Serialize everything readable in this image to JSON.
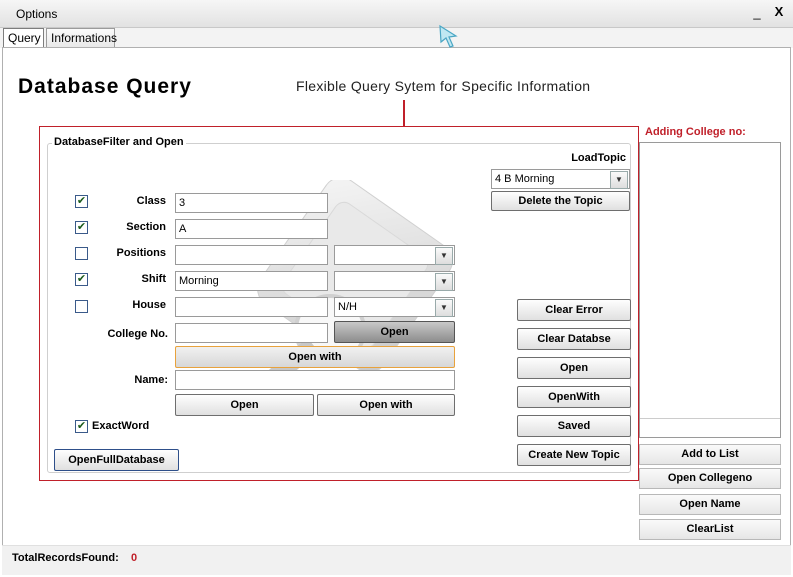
{
  "window": {
    "title": "Options",
    "minimize": "_",
    "close": "X"
  },
  "tabs": [
    {
      "label": "Query"
    },
    {
      "label": "Informations"
    }
  ],
  "page": {
    "title": "Database Query",
    "subtitle": "Flexible Query Sytem for Specific Information"
  },
  "filter": {
    "group_title": "DatabaseFilter and Open",
    "load_topic_label": "LoadTopic",
    "load_topic_value": "4 B Morning",
    "delete_topic": "Delete the Topic",
    "fields": {
      "class": {
        "label": "Class",
        "value": "3",
        "checked": true
      },
      "section": {
        "label": "Section",
        "value": "A",
        "checked": true
      },
      "positions": {
        "label": "Positions",
        "value": "",
        "checked": false,
        "select": ""
      },
      "shift": {
        "label": "Shift",
        "value": "Morning",
        "checked": true,
        "select": ""
      },
      "house": {
        "label": "House",
        "value": "",
        "checked": false,
        "select": "N/H"
      }
    },
    "college_no_label": "College No.",
    "college_no_value": "",
    "open_btn": "Open",
    "open_with_btn": "Open with",
    "name_label": "Name:",
    "name_value": "",
    "name_open_btn": "Open",
    "name_open_with_btn": "Open with",
    "exact_word_label": "ExactWord",
    "exact_word_checked": true,
    "open_full_db": "OpenFullDatabase"
  },
  "actions": {
    "clear_error": "Clear Error",
    "clear_database": "Clear Databse",
    "open": "Open",
    "open_with": "OpenWith",
    "saved": "Saved",
    "create_new_topic": "Create New Topic"
  },
  "college_list": {
    "label": "Adding College no:",
    "add_to_list": "Add to List",
    "open_collegeno": "Open Collegeno",
    "open_name": "Open Name",
    "clear_list": "ClearList"
  },
  "status": {
    "label": "TotalRecordsFound:",
    "value": "0"
  },
  "colors": {
    "accent_red": "#c0202a",
    "focus_orange": "#e8a23c"
  },
  "icons": {
    "check": "✔",
    "dropdown": "▼"
  }
}
